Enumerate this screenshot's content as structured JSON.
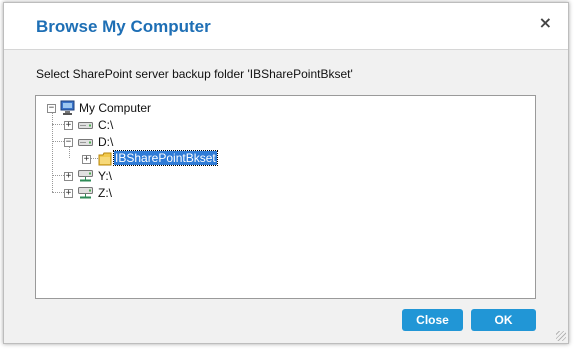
{
  "dialog": {
    "title": "Browse My Computer",
    "close_glyph": "×",
    "instruction": "Select SharePoint server backup folder 'IBSharePointBkset'"
  },
  "tree": {
    "root": {
      "label": "My Computer",
      "icon": "computer-icon",
      "expander": "−"
    },
    "nodes": [
      {
        "label": "C:\\",
        "icon": "hard-drive-icon",
        "expander": "+"
      },
      {
        "label": "D:\\",
        "icon": "hard-drive-icon",
        "expander": "−"
      },
      {
        "label": "IBSharePointBkset",
        "icon": "folder-icon",
        "expander": "+",
        "selected": true
      },
      {
        "label": "Y:\\",
        "icon": "network-drive-icon",
        "expander": "+"
      },
      {
        "label": "Z:\\",
        "icon": "network-drive-icon",
        "expander": "+"
      }
    ]
  },
  "buttons": {
    "close_label": "Close",
    "ok_label": "OK"
  },
  "colors": {
    "title": "#1e6fb5",
    "button": "#2196d6",
    "selection": "#2f7bd6"
  }
}
